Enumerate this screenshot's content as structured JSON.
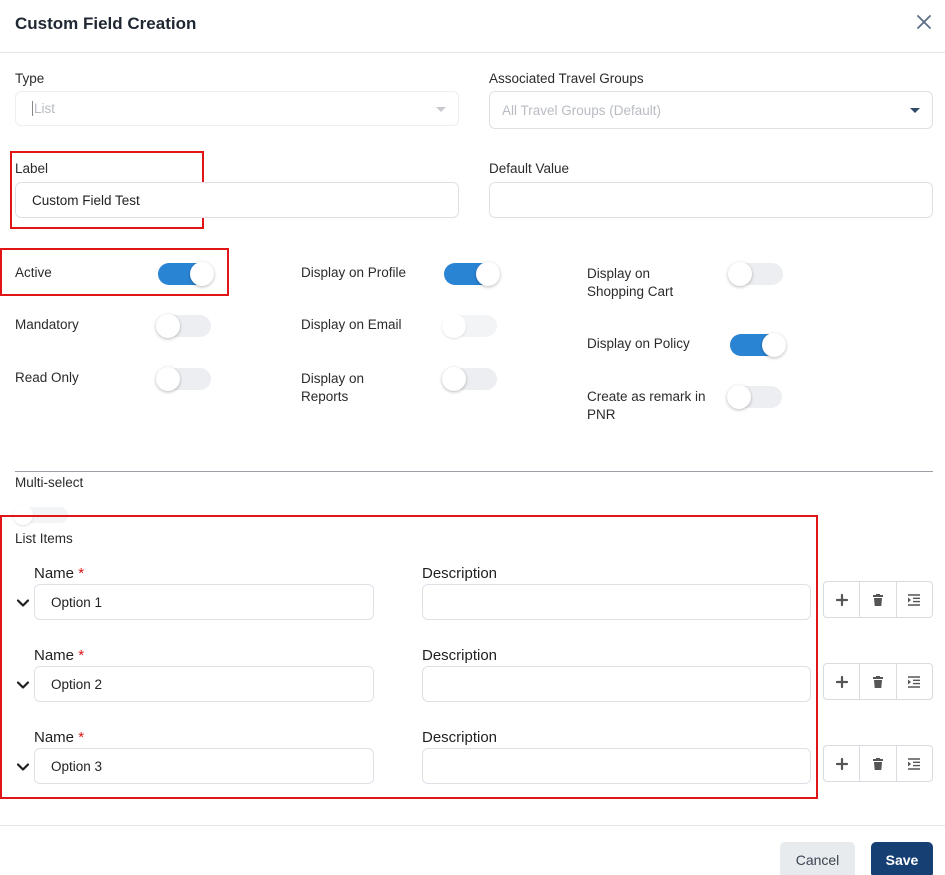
{
  "dialog": {
    "title": "Custom Field Creation"
  },
  "form": {
    "type_label": "Type",
    "type_value": "List",
    "groups_label": "Associated Travel Groups",
    "groups_placeholder": "All Travel Groups (Default)",
    "label_label": "Label",
    "label_value": "Custom Field Test",
    "default_label": "Default Value",
    "default_value": ""
  },
  "toggles": {
    "active": {
      "label": "Active",
      "on": true
    },
    "display_profile": {
      "label": "Display on Profile",
      "on": true
    },
    "display_cart": {
      "label": "Display on Shopping Cart",
      "on": false
    },
    "mandatory": {
      "label": "Mandatory",
      "on": false
    },
    "display_email": {
      "label": "Display on Email",
      "on": false
    },
    "display_policy": {
      "label": "Display on Policy",
      "on": true
    },
    "read_only": {
      "label": "Read Only",
      "on": false
    },
    "display_reports": {
      "label": "Display on Reports",
      "on": false
    },
    "remark_pnr": {
      "label": "Create as remark in PNR",
      "on": false
    },
    "multi_select": {
      "label": "Multi-select",
      "on": false
    }
  },
  "list_items": {
    "heading": "List Items",
    "name_label": "Name",
    "required_mark": "*",
    "description_label": "Description",
    "items": [
      {
        "name": "Option 1",
        "description": ""
      },
      {
        "name": "Option 2",
        "description": ""
      },
      {
        "name": "Option 3",
        "description": ""
      }
    ]
  },
  "footer": {
    "cancel_label": "Cancel",
    "save_label": "Save"
  },
  "colors": {
    "accent": "#2a84d4",
    "primary_button": "#163f73",
    "highlight": "#e01515"
  }
}
